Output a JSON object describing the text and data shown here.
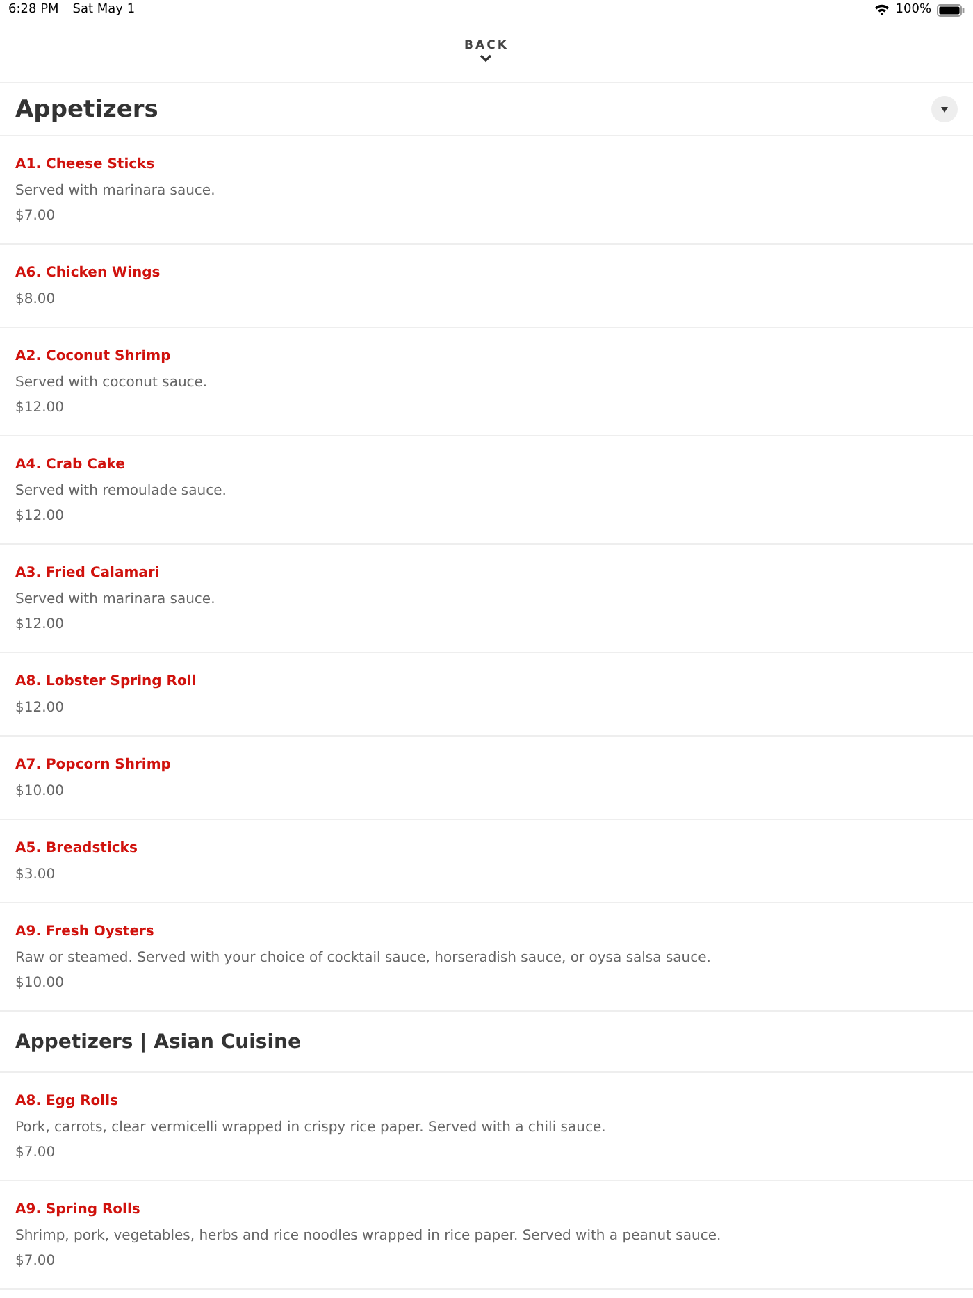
{
  "status_bar": {
    "time": "6:28 PM",
    "date": "Sat May 1",
    "battery": "100%"
  },
  "back": {
    "label": "BACK"
  },
  "sections": [
    {
      "title": "Appetizers",
      "has_toggle": true,
      "items": [
        {
          "name": "A1. Cheese Sticks",
          "description": "Served with marinara sauce.",
          "price": "$7.00"
        },
        {
          "name": "A6. Chicken Wings",
          "price": "$8.00"
        },
        {
          "name": "A2. Coconut Shrimp",
          "description": "Served with coconut sauce.",
          "price": "$12.00"
        },
        {
          "name": "A4. Crab Cake",
          "description": "Served with remoulade sauce.",
          "price": "$12.00"
        },
        {
          "name": "A3. Fried Calamari",
          "description": "Served with marinara sauce.",
          "price": "$12.00"
        },
        {
          "name": "A8. Lobster Spring Roll",
          "price": "$12.00"
        },
        {
          "name": "A7. Popcorn Shrimp",
          "price": "$10.00"
        },
        {
          "name": "A5. Breadsticks",
          "price": "$3.00"
        },
        {
          "name": "A9. Fresh Oysters",
          "description": "Raw or steamed. Served with your choice of cocktail sauce, horseradish sauce, or oysa salsa sauce.",
          "price": "$10.00"
        }
      ]
    },
    {
      "title": "Appetizers | Asian Cuisine",
      "has_toggle": false,
      "items": [
        {
          "name": "A8. Egg Rolls",
          "description": "Pork, carrots, clear vermicelli wrapped in crispy rice paper. Served with a chili sauce.",
          "price": "$7.00"
        },
        {
          "name": "A9. Spring Rolls",
          "description": "Shrimp, pork, vegetables, herbs and rice noodles wrapped in rice paper. Served with a peanut sauce.",
          "price": "$7.00"
        }
      ]
    }
  ]
}
